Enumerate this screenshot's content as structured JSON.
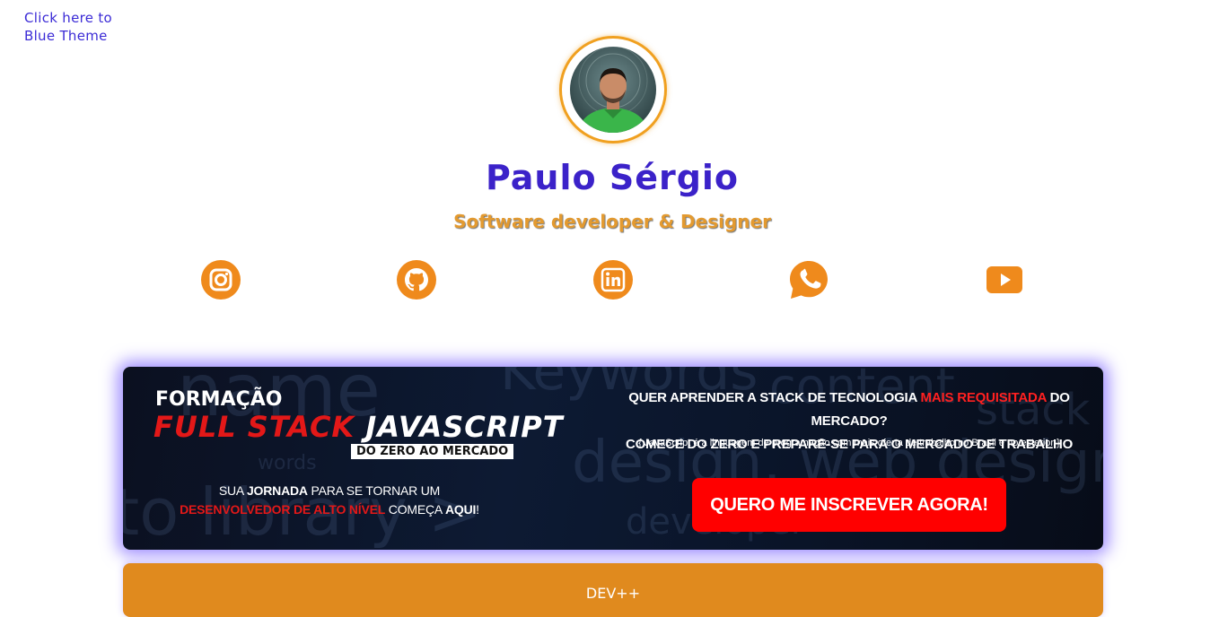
{
  "theme_link": {
    "line1": "Click here to",
    "line2": "Blue Theme"
  },
  "profile": {
    "name": "Paulo Sérgio",
    "role": "Software developer & Designer"
  },
  "social": [
    {
      "icon": "instagram-icon"
    },
    {
      "icon": "github-icon"
    },
    {
      "icon": "linkedin-icon"
    },
    {
      "icon": "whatsapp-icon"
    },
    {
      "icon": "youtube-icon"
    }
  ],
  "colors": {
    "accent": "#e39a30",
    "name": "#3b22c9",
    "cta": "#ff0000",
    "dev_card": "#e08a1e"
  },
  "banner": {
    "formacao": "FORMAÇÃO",
    "full_stack": "FULL STACK",
    "javascript": "JAVASCRIPT",
    "zero_tag": "DO ZERO AO MERCADO",
    "jornada": {
      "p1": "SUA ",
      "p2": "JORNADA",
      "p3": " PARA SE TORNAR UM",
      "p4": "DESENVOLVEDOR DE ALTO NÍVEL",
      "p5": " COMEÇA ",
      "p6": "AQUI",
      "p7": "!"
    },
    "question": {
      "p1": "QUER APRENDER A STACK DE TECNOLOGIA ",
      "p2": "MAIS REQUISITADA",
      "p3": " DO MERCADO?",
      "line2": "COMECE DO ZERO E PREPARE-SE PARA O MERCADO DE TRABALHO"
    },
    "note": "{ JavaScript é a linguagem de programação com mais oferta de trabalho no Brasil e no esterior }",
    "cta": "QUERO ME INSCREVER AGORA!"
  },
  "dev_card": {
    "label": "DEV++"
  }
}
